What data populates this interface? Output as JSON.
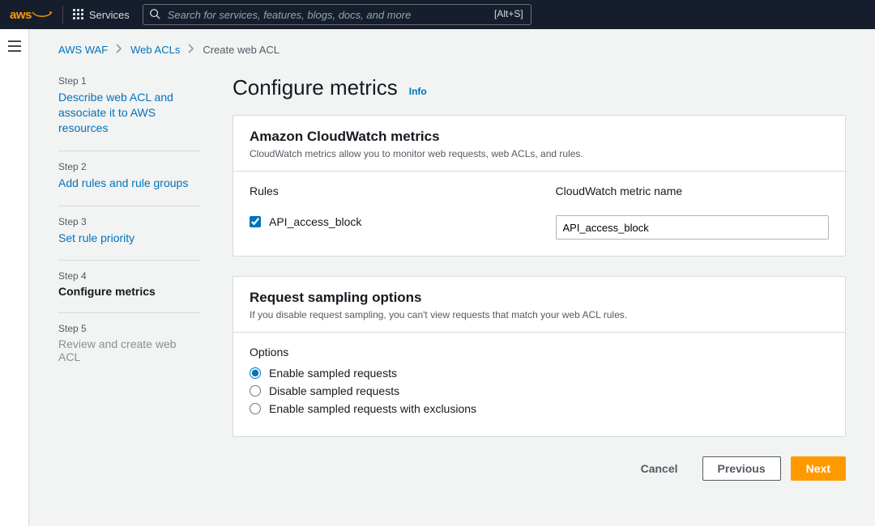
{
  "topbar": {
    "logo_text": "aws",
    "services_label": "Services",
    "search_placeholder": "Search for services, features, blogs, docs, and more",
    "search_shortcut": "[Alt+S]"
  },
  "breadcrumb": {
    "items": [
      "AWS WAF",
      "Web ACLs",
      "Create web ACL"
    ]
  },
  "steps": [
    {
      "num": "Step 1",
      "label": "Describe web ACL and associate it to AWS resources",
      "state": "link"
    },
    {
      "num": "Step 2",
      "label": "Add rules and rule groups",
      "state": "link"
    },
    {
      "num": "Step 3",
      "label": "Set rule priority",
      "state": "link"
    },
    {
      "num": "Step 4",
      "label": "Configure metrics",
      "state": "current"
    },
    {
      "num": "Step 5",
      "label": "Review and create web ACL",
      "state": "disabled"
    }
  ],
  "page": {
    "title": "Configure metrics",
    "info": "Info"
  },
  "metrics_panel": {
    "title": "Amazon CloudWatch metrics",
    "subtitle": "CloudWatch metrics allow you to monitor web requests, web ACLs, and rules.",
    "col_rules": "Rules",
    "col_metric": "CloudWatch metric name",
    "rule_name": "API_access_block",
    "metric_name_value": "API_access_block",
    "rule_checked": true
  },
  "sampling_panel": {
    "title": "Request sampling options",
    "subtitle": "If you disable request sampling, you can't view requests that match your web ACL rules.",
    "options_label": "Options",
    "options": [
      "Enable sampled requests",
      "Disable sampled requests",
      "Enable sampled requests with exclusions"
    ],
    "selected_index": 0
  },
  "footer": {
    "cancel": "Cancel",
    "previous": "Previous",
    "next": "Next"
  }
}
